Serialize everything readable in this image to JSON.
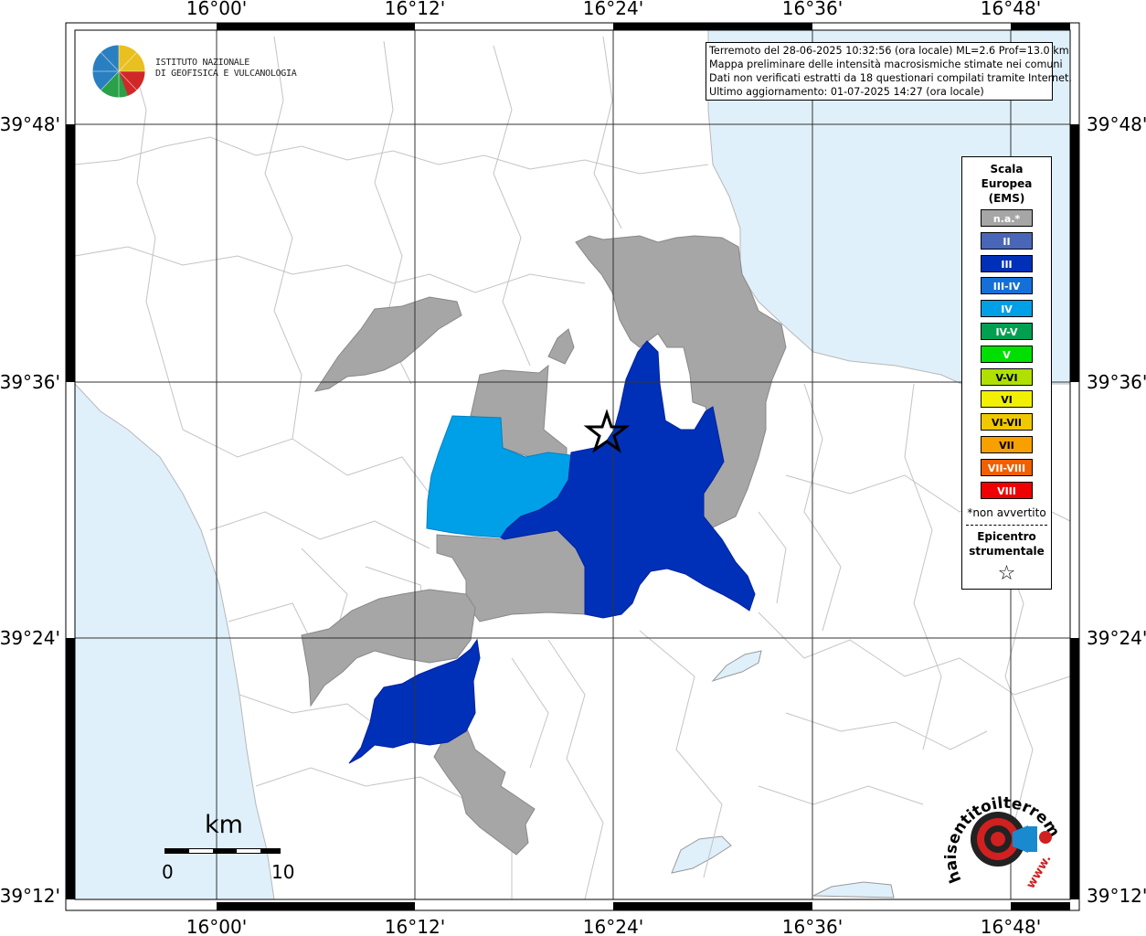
{
  "map": {
    "top_lon_labels": [
      "16°00'",
      "16°12'",
      "16°24'",
      "16°36'",
      "16°48'"
    ],
    "bottom_lon_labels": [
      "16°00'",
      "16°12'",
      "16°24'",
      "16°36'",
      "16°48'"
    ],
    "left_lat_labels": [
      "39°48'",
      "39°36'",
      "39°24'",
      "39°12'"
    ],
    "right_lat_labels": [
      "39°48'",
      "39°36'",
      "39°24'",
      "39°12'"
    ],
    "colors": {
      "sea": "#dff0fb",
      "land": "#ffffff",
      "na": "#a6a6a6",
      "ems_III": "#0030b8",
      "ems_IV": "#00a0e8",
      "borders": "#b8b8b8"
    }
  },
  "institute_logo": {
    "line1": "ISTITUTO NAZIONALE",
    "line2": "DI GEOFISICA E VULCANOLOGIA"
  },
  "info": {
    "line1": "Terremoto del 28-06-2025 10:32:56 (ora locale) ML=2.6 Prof=13.0 km",
    "line2": "Mappa preliminare delle intensità macrosismiche stimate nei comuni",
    "line3": "Dati non verificati estratti da 18 questionari compilati tramite Internet.",
    "line4": "Ultimo aggiornamento: 01-07-2025 14:27 (ora locale)"
  },
  "legend": {
    "title_line1": "Scala",
    "title_line2": "Europea",
    "title_line3": "(EMS)",
    "items": [
      {
        "label": "n.a.*",
        "color": "#a6a6a6"
      },
      {
        "label": "II",
        "color": "#4a66b8"
      },
      {
        "label": "III",
        "color": "#0030b8"
      },
      {
        "label": "III-IV",
        "color": "#1470d8"
      },
      {
        "label": "IV",
        "color": "#00a0e8"
      },
      {
        "label": "IV-V",
        "color": "#00a050"
      },
      {
        "label": "V",
        "color": "#00e000"
      },
      {
        "label": "V-VI",
        "color": "#b0e000"
      },
      {
        "label": "VI",
        "color": "#f0f000"
      },
      {
        "label": "VI-VII",
        "color": "#f0c800"
      },
      {
        "label": "VII",
        "color": "#f8a000"
      },
      {
        "label": "VII-VIII",
        "color": "#f06000"
      },
      {
        "label": "VIII",
        "color": "#f00000"
      }
    ],
    "note": "*non avvertito",
    "epicenter_line1": "Epicentro",
    "epicenter_line2": "strumentale",
    "star": "☆"
  },
  "scale_bar": {
    "unit": "km",
    "min": "0",
    "max": "10"
  },
  "hst_logo": {
    "text": "haisentitoilterremoto.it",
    "url_text": "www."
  }
}
